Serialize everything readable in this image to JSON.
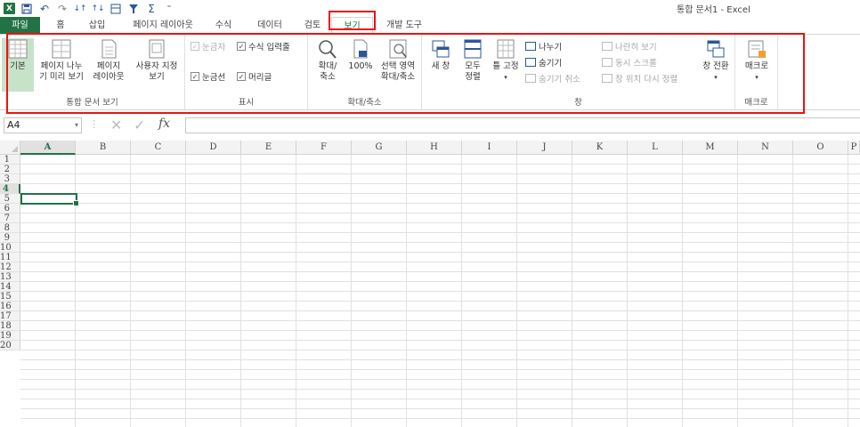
{
  "window": {
    "title": "통합 문서1 - Excel",
    "app_logo": "X"
  },
  "qat": {
    "icons": [
      "save-icon",
      "undo-icon",
      "redo-icon",
      "sort-asc-icon",
      "sort-desc-icon",
      "format-icon",
      "filter-icon",
      "sum-icon",
      "customize-icon"
    ]
  },
  "tabs": [
    {
      "label": "파일"
    },
    {
      "label": "홈"
    },
    {
      "label": "삽입"
    },
    {
      "label": "페이지 레이아웃"
    },
    {
      "label": "수식"
    },
    {
      "label": "데이터"
    },
    {
      "label": "검토"
    },
    {
      "label": "보기"
    },
    {
      "label": "개발 도구"
    }
  ],
  "ribbon": {
    "workbook_views": {
      "label": "통합 문서 보기",
      "normal": "기본",
      "page_break_1": "페이지 나누",
      "page_break_2": "기 미리 보기",
      "page_layout_1": "페이지",
      "page_layout_2": "레이아웃",
      "custom_views_1": "사용자 지정",
      "custom_views_2": "보기"
    },
    "show": {
      "label": "표시",
      "ruler": "눈금자",
      "formula_bar": "수식 입력줄",
      "gridlines": "눈금선",
      "headings": "머리글"
    },
    "zoom": {
      "label": "확대/축소",
      "zoom_1": "확대/",
      "zoom_2": "축소",
      "zoom100": "100%",
      "zoom_sel_1": "선택 영역",
      "zoom_sel_2": "확대/축소"
    },
    "window": {
      "label": "창",
      "new_window": "새 창",
      "arrange_1": "모두",
      "arrange_2": "정렬",
      "freeze": "틀 고정",
      "split": "나누기",
      "hide": "숨기기",
      "unhide": "숨기기 취소",
      "side_by_side": "나란히 보기",
      "sync_scroll": "동시 스크롤",
      "reset_pos": "창 위치 다시 정렬",
      "switch": "창 전환"
    },
    "macros": {
      "label": "매크로",
      "macros": "매크로"
    }
  },
  "formula_bar": {
    "name_box": "A4",
    "fx": "fx",
    "value": ""
  },
  "grid": {
    "columns": [
      "A",
      "B",
      "C",
      "D",
      "E",
      "F",
      "G",
      "H",
      "I",
      "J",
      "K",
      "L",
      "M",
      "N",
      "O",
      "P"
    ],
    "rows": [
      "1",
      "2",
      "3",
      "4",
      "5",
      "6",
      "7",
      "8",
      "9",
      "10",
      "11",
      "12",
      "13",
      "14",
      "15",
      "16",
      "17",
      "18",
      "19",
      "20"
    ],
    "selected_cell": "A4"
  }
}
